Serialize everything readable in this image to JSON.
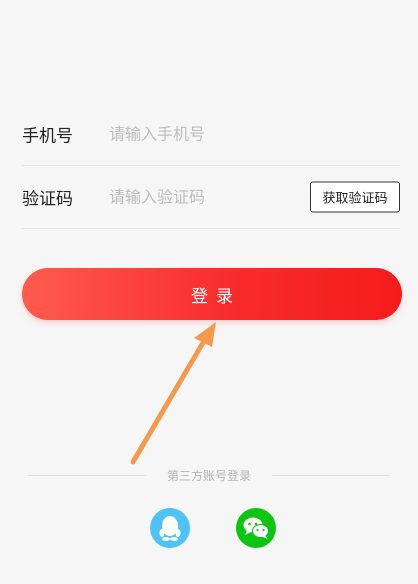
{
  "form": {
    "phone_label": "手机号",
    "phone_placeholder": "请输入手机号",
    "code_label": "验证码",
    "code_placeholder": "请输入验证码",
    "get_code_label": "获取验证码"
  },
  "login_label": "登录",
  "third_party": {
    "label": "第三方账号登录",
    "providers": [
      {
        "name": "qq",
        "icon": "qq-icon",
        "color": "#4fc3f7"
      },
      {
        "name": "wechat",
        "icon": "wechat-icon",
        "color": "#0bc511"
      }
    ]
  },
  "colors": {
    "accent": "#f82c2c",
    "annotation_arrow": "#f39a4f"
  }
}
